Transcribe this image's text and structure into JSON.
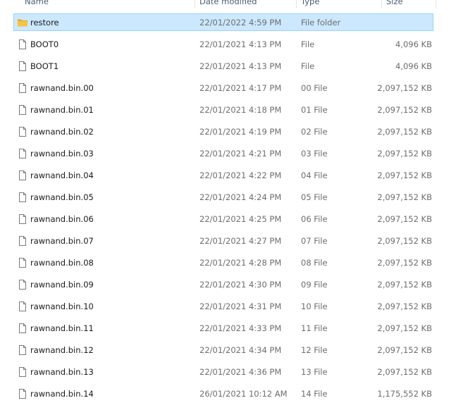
{
  "columns": {
    "name": "Name",
    "date": "Date modified",
    "type": "Type",
    "size": "Size"
  },
  "colors": {
    "selection_bg": "#cce8ff",
    "selection_border": "#99d1ff",
    "folder": "#f8c33e",
    "header_text": "#4c607a"
  },
  "rows": [
    {
      "name": "restore",
      "date": "22/01/2022 4:59 PM",
      "type": "File folder",
      "size": "",
      "icon": "folder-icon",
      "selected": true
    },
    {
      "name": "BOOT0",
      "date": "22/01/2021 4:13 PM",
      "type": "File",
      "size": "4,096 KB",
      "icon": "file-icon"
    },
    {
      "name": "BOOT1",
      "date": "22/01/2021 4:13 PM",
      "type": "File",
      "size": "4,096 KB",
      "icon": "file-icon"
    },
    {
      "name": "rawnand.bin.00",
      "date": "22/01/2021 4:17 PM",
      "type": "00 File",
      "size": "2,097,152 KB",
      "icon": "file-icon"
    },
    {
      "name": "rawnand.bin.01",
      "date": "22/01/2021 4:18 PM",
      "type": "01 File",
      "size": "2,097,152 KB",
      "icon": "file-icon"
    },
    {
      "name": "rawnand.bin.02",
      "date": "22/01/2021 4:19 PM",
      "type": "02 File",
      "size": "2,097,152 KB",
      "icon": "file-icon"
    },
    {
      "name": "rawnand.bin.03",
      "date": "22/01/2021 4:21 PM",
      "type": "03 File",
      "size": "2,097,152 KB",
      "icon": "file-icon"
    },
    {
      "name": "rawnand.bin.04",
      "date": "22/01/2021 4:22 PM",
      "type": "04 File",
      "size": "2,097,152 KB",
      "icon": "file-icon"
    },
    {
      "name": "rawnand.bin.05",
      "date": "22/01/2021 4:24 PM",
      "type": "05 File",
      "size": "2,097,152 KB",
      "icon": "file-icon"
    },
    {
      "name": "rawnand.bin.06",
      "date": "22/01/2021 4:25 PM",
      "type": "06 File",
      "size": "2,097,152 KB",
      "icon": "file-icon"
    },
    {
      "name": "rawnand.bin.07",
      "date": "22/01/2021 4:27 PM",
      "type": "07 File",
      "size": "2,097,152 KB",
      "icon": "file-icon"
    },
    {
      "name": "rawnand.bin.08",
      "date": "22/01/2021 4:28 PM",
      "type": "08 File",
      "size": "2,097,152 KB",
      "icon": "file-icon"
    },
    {
      "name": "rawnand.bin.09",
      "date": "22/01/2021 4:30 PM",
      "type": "09 File",
      "size": "2,097,152 KB",
      "icon": "file-icon"
    },
    {
      "name": "rawnand.bin.10",
      "date": "22/01/2021 4:31 PM",
      "type": "10 File",
      "size": "2,097,152 KB",
      "icon": "file-icon"
    },
    {
      "name": "rawnand.bin.11",
      "date": "22/01/2021 4:33 PM",
      "type": "11 File",
      "size": "2,097,152 KB",
      "icon": "file-icon"
    },
    {
      "name": "rawnand.bin.12",
      "date": "22/01/2021 4:34 PM",
      "type": "12 File",
      "size": "2,097,152 KB",
      "icon": "file-icon"
    },
    {
      "name": "rawnand.bin.13",
      "date": "22/01/2021 4:36 PM",
      "type": "13 File",
      "size": "2,097,152 KB",
      "icon": "file-icon"
    },
    {
      "name": "rawnand.bin.14",
      "date": "26/01/2021 10:12 AM",
      "type": "14 File",
      "size": "1,175,552 KB",
      "icon": "file-icon"
    }
  ]
}
